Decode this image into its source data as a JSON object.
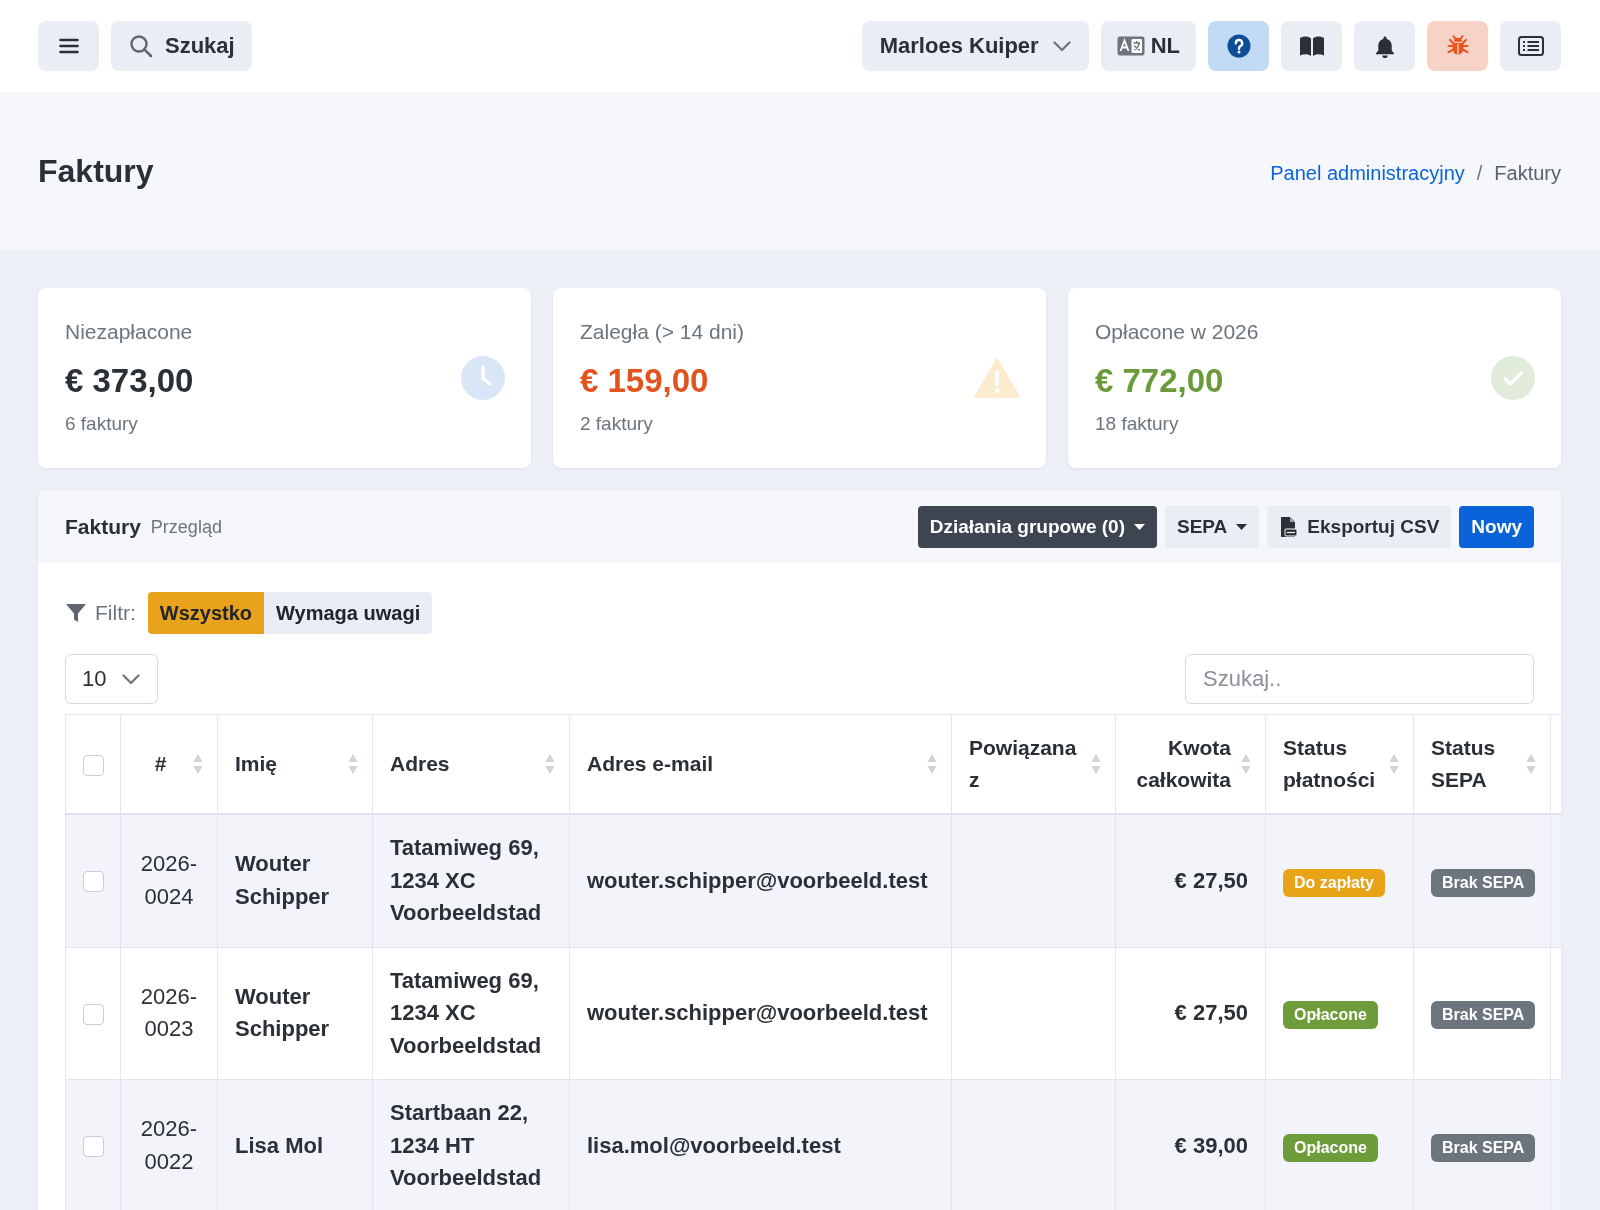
{
  "topbar": {
    "search": {
      "label": "Szukaj"
    },
    "user": {
      "name": "Marloes Kuiper"
    },
    "language": {
      "code": "NL"
    },
    "tools": [
      {
        "kind": "help"
      },
      {
        "kind": "book"
      },
      {
        "kind": "notifications"
      },
      {
        "kind": "bug"
      },
      {
        "kind": "list"
      }
    ]
  },
  "page_header": {
    "title": "Faktury",
    "breadcrumb": [
      {
        "label": "Panel administracyjny",
        "link": true
      },
      {
        "label": "Faktury",
        "link": false
      }
    ],
    "separator": "/"
  },
  "stats": [
    {
      "kind": "pending",
      "label": "Niezapłacone",
      "amount": "€ 373,00",
      "count": "6 faktury"
    },
    {
      "kind": "overdue",
      "label": "Zaległa (> 14 dni)",
      "amount": "€ 159,00",
      "count": "2 faktury"
    },
    {
      "kind": "paid",
      "label": "Opłacone w 2026",
      "amount": "€ 772,00",
      "count": "18 faktury"
    }
  ],
  "panel": {
    "title": "Faktury",
    "subtitle": "Przegląd",
    "actions": [
      {
        "label": "Działania grupowe (0)",
        "kind": "dark",
        "dropdown": true
      },
      {
        "label": "SEPA",
        "kind": "light",
        "dropdown": true
      },
      {
        "label": "Eksportuj CSV",
        "kind": "export",
        "dropdown": false
      },
      {
        "label": "Nowy",
        "kind": "primary",
        "dropdown": false
      }
    ],
    "filter": {
      "label": "Filtr:",
      "options": [
        {
          "label": "Wszystko",
          "selected": true
        },
        {
          "label": "Wymaga uwagi",
          "selected": false
        }
      ]
    },
    "page_size": {
      "value": "10"
    },
    "search": {
      "placeholder": "Szukaj.."
    },
    "table": {
      "select_all": {
        "checked": false
      },
      "columns": [
        {
          "label": "#",
          "sortable": true
        },
        {
          "label": "Imię",
          "sortable": true
        },
        {
          "label": "Adres",
          "sortable": true
        },
        {
          "label": "Adres e-mail",
          "sortable": true
        },
        {
          "label": "Powiązana z",
          "sortable": true
        },
        {
          "label": "Kwota całkowita",
          "sortable": true
        },
        {
          "label": "Status płatności",
          "sortable": true
        },
        {
          "label": "Status SEPA",
          "sortable": true
        }
      ],
      "rows": [
        {
          "checked": false,
          "number": "2026-0024",
          "name": "Wouter Schipper",
          "address": "Tatamiweg 69, 1234 XC Voorbeeldstad",
          "email": "wouter.schipper@voorbeeld.test",
          "total": "€ 27,50",
          "payment_status": {
            "label": "Do zapłaty",
            "color": "#e8a317"
          },
          "sepa_status": {
            "label": "Brak SEPA",
            "color": "#6c757d"
          }
        },
        {
          "checked": false,
          "number": "2026-0023",
          "name": "Wouter Schipper",
          "address": "Tatamiweg 69, 1234 XC Voorbeeldstad",
          "email": "wouter.schipper@voorbeeld.test",
          "total": "€ 27,50",
          "payment_status": {
            "label": "Opłacone",
            "color": "#6e9c3b"
          },
          "sepa_status": {
            "label": "Brak SEPA",
            "color": "#6c757d"
          }
        },
        {
          "checked": false,
          "number": "2026-0022",
          "name": "Lisa Mol",
          "address": "Startbaan 22, 1234 HT Voorbeeldstad",
          "email": "lisa.mol@voorbeeld.test",
          "total": "€ 39,00",
          "payment_status": {
            "label": "Opłacone",
            "color": "#6e9c3b"
          },
          "sepa_status": {
            "label": "Brak SEPA",
            "color": "#6c757d"
          }
        }
      ]
    }
  }
}
